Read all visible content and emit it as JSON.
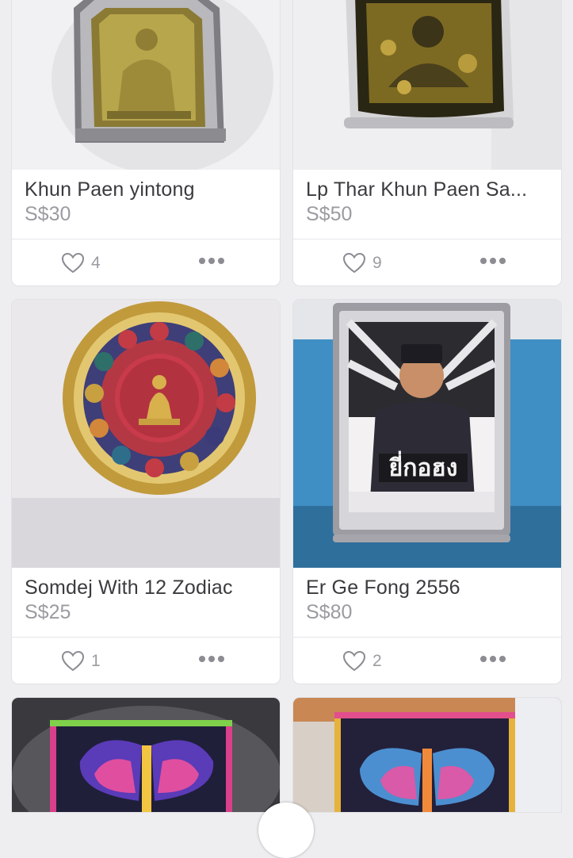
{
  "listings": [
    {
      "title": "Khun Paen yintong",
      "price": "S$30",
      "likes": "4"
    },
    {
      "title": "Lp Thar Khun Paen Sa...",
      "price": "S$50",
      "likes": "9"
    },
    {
      "title": "Somdej With 12 Zodiac",
      "price": "S$25",
      "likes": "1"
    },
    {
      "title": "Er Ge Fong 2556",
      "price": "S$80",
      "likes": "2"
    },
    {
      "title": "",
      "price": "",
      "likes": ""
    },
    {
      "title": "",
      "price": "",
      "likes": ""
    }
  ],
  "icons": {
    "like": "heart-outline-icon",
    "more": "more-horizontal-icon"
  },
  "colors": {
    "background": "#eeeef0",
    "card": "#ffffff",
    "title": "#3b3b3f",
    "price": "#9b9ba2"
  }
}
